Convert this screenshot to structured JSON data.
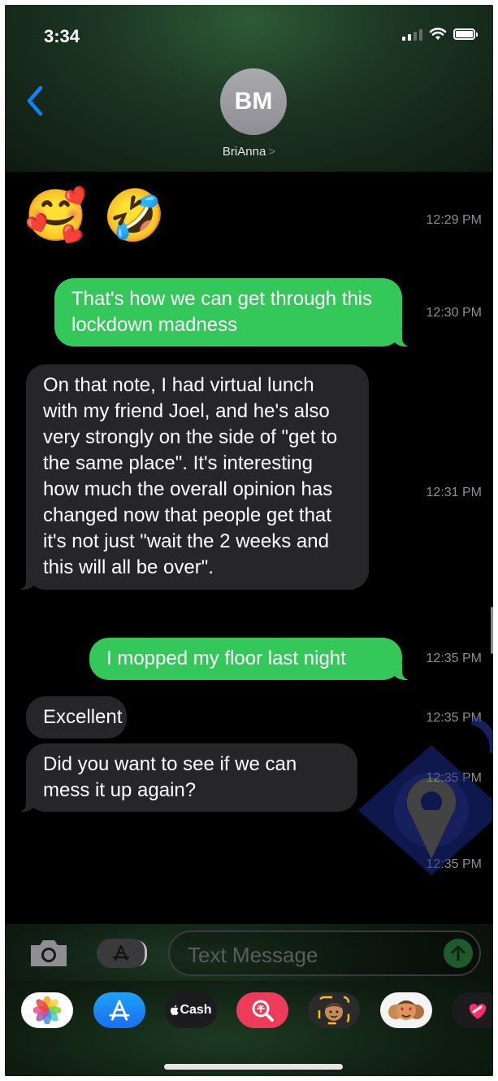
{
  "status_bar": {
    "time": "3:34"
  },
  "header": {
    "back_icon": "chevron-left-icon",
    "avatar_initials": "BM",
    "contact_name": "BriAnna",
    "contact_chevron": ">"
  },
  "messages": [
    {
      "direction": "incoming",
      "kind": "emoji",
      "text": "🥰 🤣",
      "time": "12:29 PM"
    },
    {
      "direction": "outgoing",
      "kind": "text",
      "text": "That's how we can get through this lockdown madness",
      "time": "12:30 PM"
    },
    {
      "direction": "incoming",
      "kind": "text",
      "text": "On that note, I had virtual lunch with my friend Joel, and he's also very strongly on the side of  \"get to the same place\". It's interesting how much the overall opinion has changed now that people get that it's not just \"wait the 2 weeks and this will all be over\".",
      "time": "12:31 PM"
    },
    {
      "direction": "outgoing",
      "kind": "text",
      "text": "I mopped my floor last night",
      "time": "12:35 PM"
    },
    {
      "direction": "incoming",
      "kind": "text",
      "text": "Excellent",
      "time": "12:35 PM"
    },
    {
      "direction": "incoming",
      "kind": "text",
      "text": "Did you want to see if we can mess it up again?",
      "time": "12:35 PM"
    },
    {
      "direction": "incoming",
      "kind": "emoji",
      "text": "😆",
      "time": "12:35 PM"
    }
  ],
  "composer": {
    "placeholder": "Text Message",
    "camera_icon": "camera-icon",
    "apps_icon": "app-store-icon",
    "send_icon": "arrow-up-icon"
  },
  "app_drawer": [
    {
      "name": "photos-app-icon",
      "label": ""
    },
    {
      "name": "app-store-app-icon",
      "label": ""
    },
    {
      "name": "apple-cash-app-icon",
      "label": "Cash"
    },
    {
      "name": "web-images-app-icon",
      "label": ""
    },
    {
      "name": "memoji-app-icon",
      "label": ""
    },
    {
      "name": "memoji-stickers-app-icon",
      "label": ""
    },
    {
      "name": "digital-touch-app-icon",
      "label": ""
    }
  ],
  "colors": {
    "outgoing_bubble": "#34c759",
    "incoming_bubble": "#262628",
    "accent_blue": "#0a84ff",
    "timestamp": "#8e8e93"
  }
}
